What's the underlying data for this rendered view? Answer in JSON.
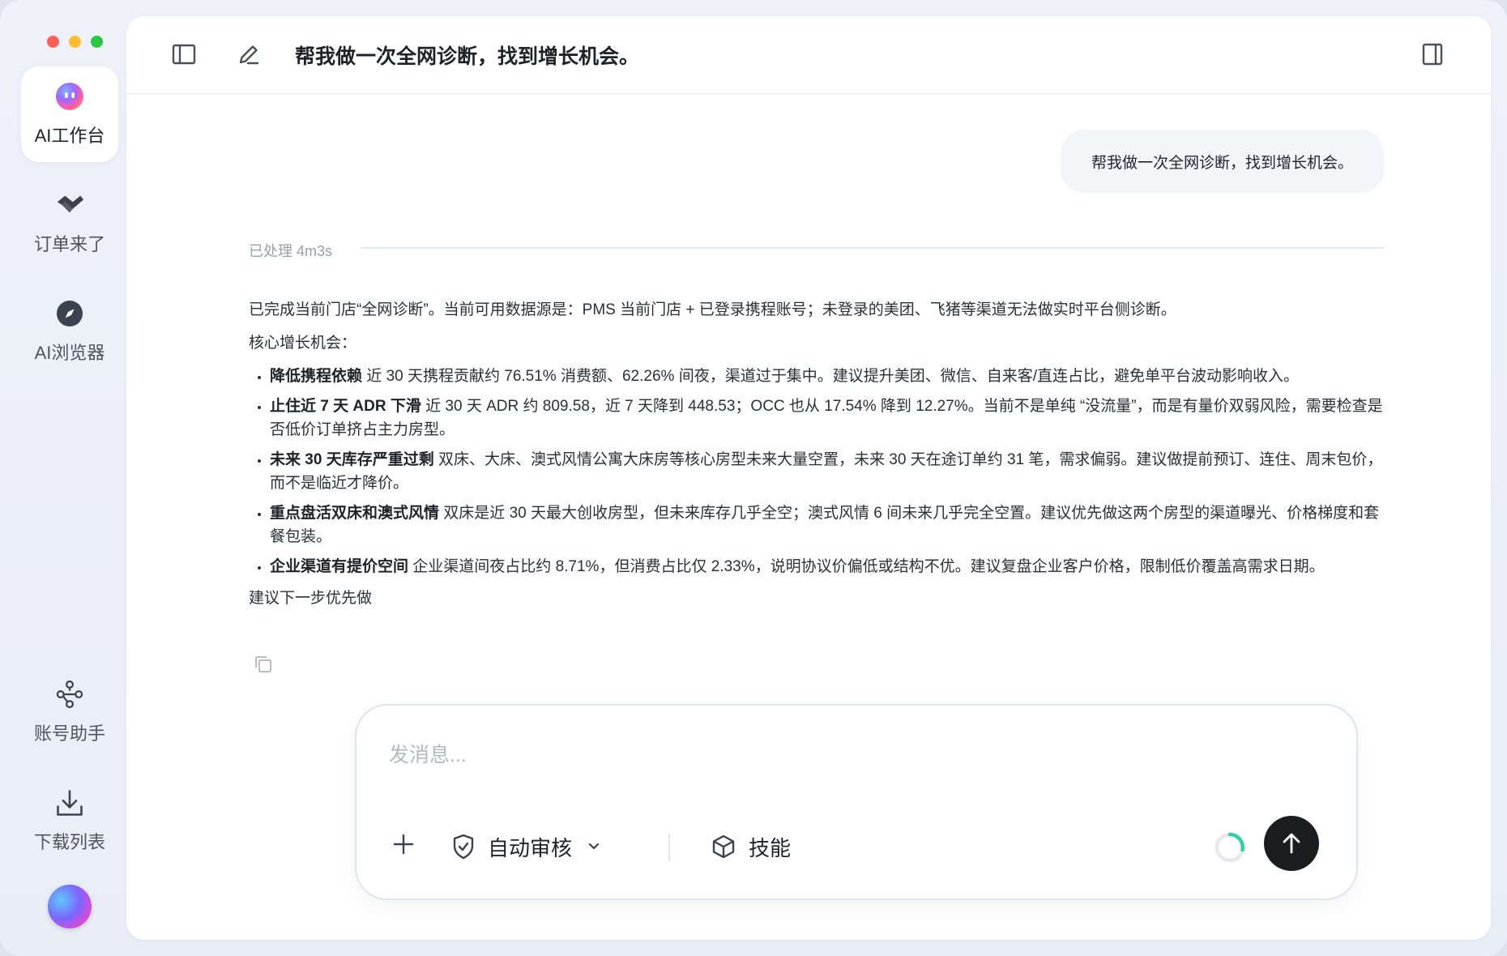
{
  "sidebar": {
    "items": [
      {
        "label": "AI工作台",
        "icon": "ai-workbench-icon",
        "active": true
      },
      {
        "label": "订单来了",
        "icon": "order-logo-icon",
        "active": false
      },
      {
        "label": "AI浏览器",
        "icon": "compass-icon",
        "active": false
      },
      {
        "label": "账号助手",
        "icon": "account-network-icon",
        "active": false
      },
      {
        "label": "下载列表",
        "icon": "download-icon",
        "active": false
      }
    ]
  },
  "header": {
    "title": "帮我做一次全网诊断，找到增长机会。"
  },
  "chat": {
    "user_message": "帮我做一次全网诊断，找到增长机会。",
    "processed_label": "已处理 4m3s",
    "intro": "已完成当前门店“全网诊断”。当前可用数据源是：PMS 当前门店 + 已登录携程账号；未登录的美团、飞猪等渠道无法做实时平台侧诊断。",
    "section_title": "核心增长机会：",
    "bullets": [
      {
        "title": "降低携程依赖",
        "text": " 近 30 天携程贡献约 76.51% 消费额、62.26% 间夜，渠道过于集中。建议提升美团、微信、自来客/直连占比，避免单平台波动影响收入。"
      },
      {
        "title": "止住近 7 天 ADR 下滑",
        "text": " 近 30 天 ADR 约 809.58，近 7 天降到 448.53；OCC 也从 17.54% 降到 12.27%。当前不是单纯 “没流量”，而是有量价双弱风险，需要检查是否低价订单挤占主力房型。"
      },
      {
        "title": "未来 30 天库存严重过剩",
        "text": " 双床、大床、澳式风情公寓大床房等核心房型未来大量空置，未来 30 天在途订单约 31 笔，需求偏弱。建议做提前预订、连住、周末包价，而不是临近才降价。"
      },
      {
        "title": "重点盘活双床和澳式风情",
        "text": " 双床是近 30 天最大创收房型，但未来库存几乎全空；澳式风情 6 间未来几乎完全空置。建议优先做这两个房型的渠道曝光、价格梯度和套餐包装。"
      },
      {
        "title": "企业渠道有提价空间",
        "text": " 企业渠道间夜占比约 8.71%，但消费占比仅 2.33%，说明协议价偏低或结构不优。建议复盘企业客户价格，限制低价覆盖高需求日期。"
      }
    ],
    "next_step": "建议下一步优先做"
  },
  "composer": {
    "placeholder": "发消息...",
    "auto_review_label": "自动审核",
    "skills_label": "技能"
  },
  "colors": {
    "traffic_red": "#ff5f57",
    "traffic_yellow": "#febc2e",
    "traffic_green": "#28c840",
    "send_button": "#1c1d1f",
    "spinner_accent": "#2fd1a6"
  }
}
